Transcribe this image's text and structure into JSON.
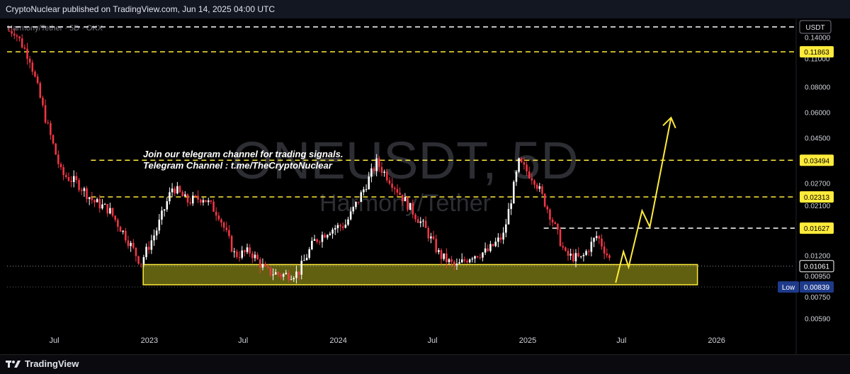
{
  "header": {
    "published": "CryptoNuclear published on TradingView.com, Jun 14, 2025 04:00 UTC"
  },
  "symbol_line": "Harmony/Tether · 5D · OKX",
  "watermark": {
    "ticker": "ONEUSDT, 5D",
    "name": "Harmony/Tether"
  },
  "annotation": {
    "line1": "Join our telegram channel for trading signals.",
    "line2": "Telegram Channel : t.me/TheCryptoNuclear"
  },
  "footer": {
    "brand": "TradingView"
  },
  "colors": {
    "background": "#000000",
    "up_candle": "#ffffff",
    "down_candle": "#f23645",
    "level_line": "#ffeb3b",
    "support_zone": "#6b6a12",
    "arrow": "#ffeb3b",
    "axis_text": "#d1d4dc"
  },
  "chart_data": {
    "type": "candlestick",
    "title": "ONEUSDT, 5D",
    "subtitle": "Harmony/Tether",
    "yscale": "log",
    "currency_label": "USDT",
    "ylim": [
      0.005,
      0.17
    ],
    "y_ticks": [
      "0.14000",
      "0.11000",
      "0.08000",
      "0.06000",
      "0.04500",
      "0.02700",
      "0.02100",
      "0.01200",
      "0.00950",
      "0.00750",
      "0.00590"
    ],
    "x_ticks": [
      "Jul",
      "2023",
      "Jul",
      "2024",
      "Jul",
      "2025",
      "Jul",
      "2026"
    ],
    "horizontal_levels": [
      {
        "label": "USDT",
        "value": 0.157,
        "style": "dashed-white",
        "badge": false
      },
      {
        "label": "0.11863",
        "value": 0.11863,
        "style": "dashed-yellow",
        "badge": true
      },
      {
        "label": "0.03494",
        "value": 0.03494,
        "style": "dashed-yellow",
        "badge": true
      },
      {
        "label": "0.02313",
        "value": 0.02313,
        "style": "dashed-yellow",
        "badge": true
      },
      {
        "label": "0.01627",
        "value": 0.01627,
        "style": "dashed-white",
        "badge": true
      }
    ],
    "current_price": {
      "label": "0.01061",
      "value": 0.01061
    },
    "low_marker": {
      "tag": "Low",
      "label": "0.00839",
      "value": 0.00839
    },
    "support_zone": {
      "low": 0.0086,
      "high": 0.0108,
      "from": "2022-12",
      "to": "2025-11"
    },
    "projection": [
      {
        "date": "2025-06-20",
        "price": 0.0088
      },
      {
        "date": "2025-07-05",
        "price": 0.0125
      },
      {
        "date": "2025-07-15",
        "price": 0.0105
      },
      {
        "date": "2025-08-10",
        "price": 0.0198
      },
      {
        "date": "2025-08-25",
        "price": 0.0165
      },
      {
        "date": "2025-10-05",
        "price": 0.0565
      }
    ],
    "series": [
      {
        "date": "2022-04",
        "close": 0.15
      },
      {
        "date": "2022-05",
        "close": 0.11
      },
      {
        "date": "2022-06",
        "close": 0.055
      },
      {
        "date": "2022-07",
        "close": 0.03
      },
      {
        "date": "2022-08",
        "close": 0.027
      },
      {
        "date": "2022-09",
        "close": 0.022
      },
      {
        "date": "2022-10",
        "close": 0.02
      },
      {
        "date": "2022-11",
        "close": 0.015
      },
      {
        "date": "2022-12",
        "close": 0.011
      },
      {
        "date": "2023-01",
        "close": 0.016
      },
      {
        "date": "2023-02",
        "close": 0.026
      },
      {
        "date": "2023-03",
        "close": 0.022
      },
      {
        "date": "2023-04",
        "close": 0.023
      },
      {
        "date": "2023-05",
        "close": 0.019
      },
      {
        "date": "2023-06",
        "close": 0.012
      },
      {
        "date": "2023-07",
        "close": 0.0125
      },
      {
        "date": "2023-08",
        "close": 0.01
      },
      {
        "date": "2023-09",
        "close": 0.0096
      },
      {
        "date": "2023-10",
        "close": 0.0098
      },
      {
        "date": "2023-11",
        "close": 0.014
      },
      {
        "date": "2023-12",
        "close": 0.016
      },
      {
        "date": "2024-01",
        "close": 0.017
      },
      {
        "date": "2024-02",
        "close": 0.024
      },
      {
        "date": "2024-03",
        "close": 0.034
      },
      {
        "date": "2024-04",
        "close": 0.027
      },
      {
        "date": "2024-05",
        "close": 0.021
      },
      {
        "date": "2024-06",
        "close": 0.0165
      },
      {
        "date": "2024-07",
        "close": 0.012
      },
      {
        "date": "2024-08",
        "close": 0.0105
      },
      {
        "date": "2024-09",
        "close": 0.012
      },
      {
        "date": "2024-10",
        "close": 0.0125
      },
      {
        "date": "2024-11",
        "close": 0.015
      },
      {
        "date": "2024-12",
        "close": 0.034
      },
      {
        "date": "2025-01",
        "close": 0.028
      },
      {
        "date": "2025-02",
        "close": 0.0185
      },
      {
        "date": "2025-03",
        "close": 0.012
      },
      {
        "date": "2025-04",
        "close": 0.0115
      },
      {
        "date": "2025-05",
        "close": 0.015
      },
      {
        "date": "2025-06",
        "close": 0.0106
      }
    ]
  }
}
